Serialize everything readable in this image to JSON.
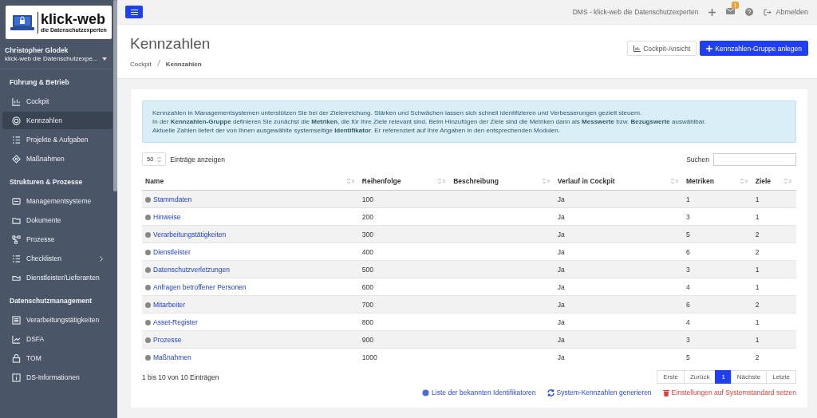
{
  "sidebar": {
    "logo": {
      "title": "klick-web",
      "subtitle": "die Datenschutzexperten"
    },
    "user": {
      "name": "Christopher Glodek",
      "org": "klick-web die Datenschutzexpe..."
    },
    "sections": [
      {
        "title": "Führung & Betrieb",
        "items": [
          {
            "label": "Cockpit",
            "selected": false,
            "submenu": false
          },
          {
            "label": "Kennzahlen",
            "selected": true,
            "submenu": false
          },
          {
            "label": "Projekte & Aufgaben",
            "selected": false,
            "submenu": false
          },
          {
            "label": "Maßnahmen",
            "selected": false,
            "submenu": false
          }
        ]
      },
      {
        "title": "Strukturen & Prozesse",
        "items": [
          {
            "label": "Managementsysteme",
            "selected": false,
            "submenu": false
          },
          {
            "label": "Dokumente",
            "selected": false,
            "submenu": false
          },
          {
            "label": "Prozesse",
            "selected": false,
            "submenu": false
          },
          {
            "label": "Checklisten",
            "selected": false,
            "submenu": true
          },
          {
            "label": "Dienstleister/Lieferanten",
            "selected": false,
            "submenu": false
          }
        ]
      },
      {
        "title": "Datenschutzmanagement",
        "items": [
          {
            "label": "Verarbeitungstätigkeiten",
            "selected": false,
            "submenu": false
          },
          {
            "label": "DSFA",
            "selected": false,
            "submenu": false
          },
          {
            "label": "TOM",
            "selected": false,
            "submenu": false
          },
          {
            "label": "DS-Informationen",
            "selected": false,
            "submenu": false
          }
        ]
      }
    ]
  },
  "topbar": {
    "title": "DMS - klick-web die Datenschutzexperten",
    "mail_badge": "1",
    "logout": "Abmelden"
  },
  "header": {
    "title": "Kennzahlen",
    "breadcrumb": [
      "Cockpit",
      "Kennzahlen"
    ],
    "buttons": [
      "Cockpit-Ansicht",
      "Kennzahlen-Gruppe anlegen"
    ]
  },
  "info": [
    "Kennzahlen in Managementsystemen unterstützen Sie bei der Zielerreichung. Stärken und Schwächen lassen sich schnell identifizieren und Verbesserungen gezielt steuern.",
    "In der **Kennzahlen-Gruppe** definieren Sie zunächst die **Metriken**, die für Ihre Ziele relevant sind. Beim Hinzufügen der Ziele sind die Metriken dann als **Messwerte** bzw. **Bezugswerte** auswählbar.",
    "Aktuelle Zahlen liefert der von Ihnen ausgewählte systemseitige **Identifikator**. Er referenziert auf Ihre Angaben in den entsprechenden Modulen."
  ],
  "length": {
    "value": "50",
    "label": "Einträge anzeigen"
  },
  "search": {
    "label": "Suchen"
  },
  "table": {
    "columns": [
      "Name",
      "Reihenfolge",
      "Beschreibung",
      "Verlauf in Cockpit",
      "Metriken",
      "Ziele"
    ],
    "rows": [
      [
        "Stammdaten",
        "100",
        "",
        "Ja",
        "1",
        "1"
      ],
      [
        "Hinweise",
        "200",
        "",
        "Ja",
        "3",
        "1"
      ],
      [
        "Verarbeitungstätigkeiten",
        "300",
        "",
        "Ja",
        "5",
        "2"
      ],
      [
        "Dienstleister",
        "400",
        "",
        "Ja",
        "6",
        "2"
      ],
      [
        "Datenschutzverletzungen",
        "500",
        "",
        "Ja",
        "3",
        "1"
      ],
      [
        "Anfragen betroffener Personen",
        "600",
        "",
        "Ja",
        "4",
        "1"
      ],
      [
        "Mitarbeiter",
        "700",
        "",
        "Ja",
        "6",
        "2"
      ],
      [
        "Asset-Register",
        "800",
        "",
        "Ja",
        "4",
        "1"
      ],
      [
        "Prozesse",
        "900",
        "",
        "Ja",
        "3",
        "1"
      ],
      [
        "Maßnahmen",
        "1000",
        "",
        "Ja",
        "5",
        "2"
      ]
    ]
  },
  "table_info": "1 bis 10 von 10 Einträgen",
  "pagination": [
    {
      "label": "Erste",
      "selected": false
    },
    {
      "label": "Zurück",
      "selected": false
    },
    {
      "label": "1",
      "selected": true
    },
    {
      "label": "Nächste",
      "selected": false
    },
    {
      "label": "Letzte",
      "selected": false
    }
  ],
  "actions": [
    {
      "label": "Liste der bekannten Identifikatoren",
      "kind": "info"
    },
    {
      "label": "System-Kennzahlen generieren",
      "kind": "refresh"
    },
    {
      "label": "Einstellungen auf Systemstandard setzen",
      "kind": "danger"
    }
  ]
}
